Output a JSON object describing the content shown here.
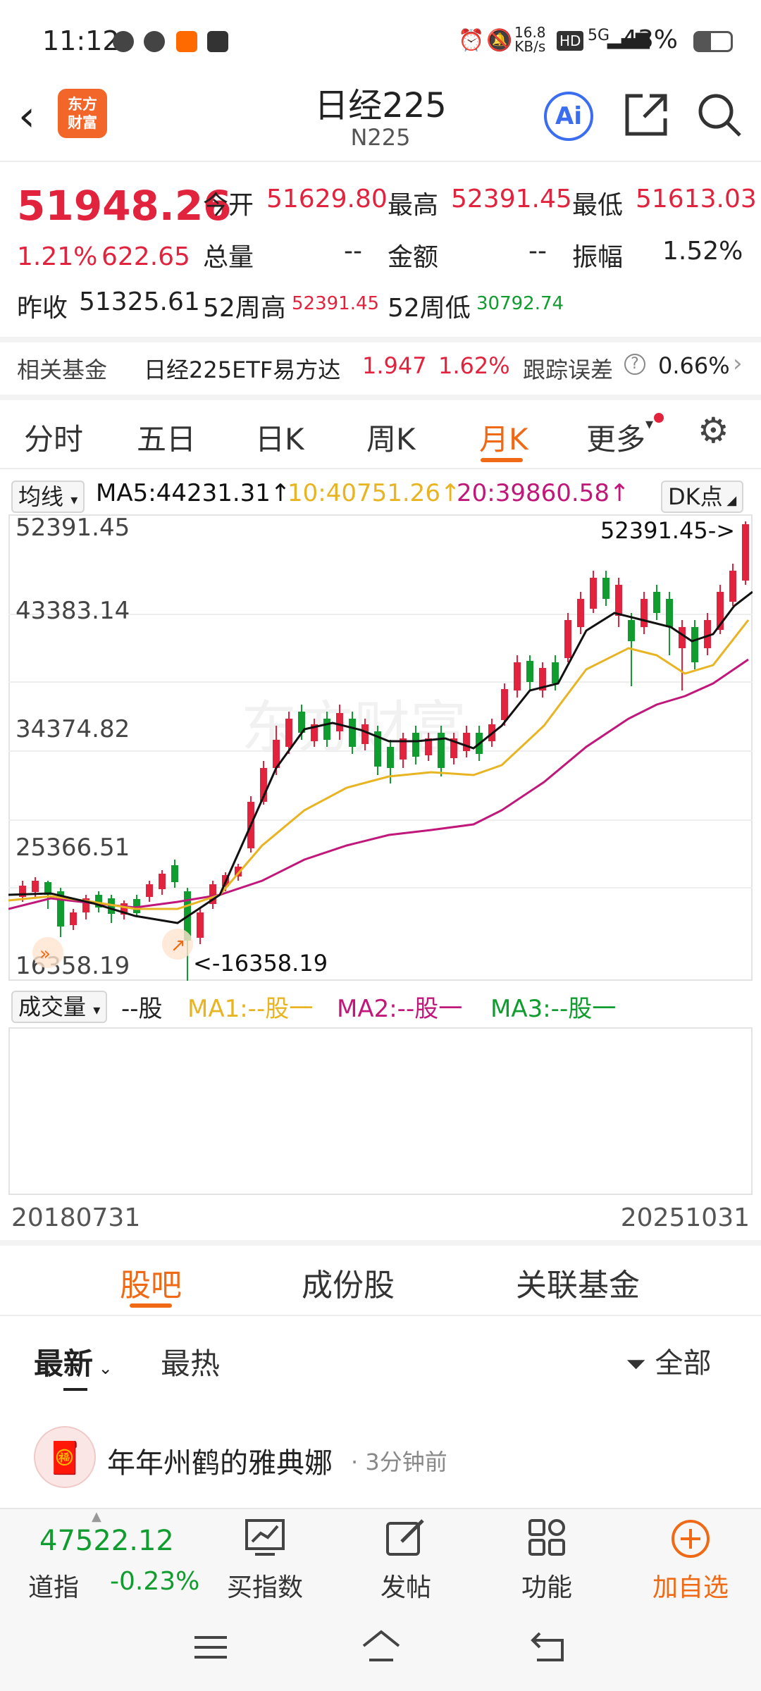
{
  "status_bar": {
    "time": "11:12",
    "speed": "16.8",
    "speed_unit": "KB/s",
    "network": "5G",
    "battery": "43%"
  },
  "header": {
    "title": "日经225",
    "subtitle": "N225",
    "logo_text_1": "东方",
    "logo_text_2": "财富",
    "ai_label": "Ai"
  },
  "quote": {
    "price": "51948.26",
    "change_pct": "1.21%",
    "change": "622.65",
    "prev_close_label": "昨收",
    "prev_close": "51325.61",
    "open_label": "今开",
    "open": "51629.80",
    "high_label": "最高",
    "high": "52391.45",
    "low_label": "最低",
    "low": "51613.03",
    "volume_label": "总量",
    "volume": "--",
    "amount_label": "金额",
    "amount": "--",
    "amplitude_label": "振幅",
    "amplitude": "1.52%",
    "w52_high_label": "52周高",
    "w52_high": "52391.45",
    "w52_low_label": "52周低",
    "w52_low": "30792.74"
  },
  "fund_row": {
    "label": "相关基金",
    "fund_name": "日经225ETF易方达",
    "fund_price": "1.947",
    "fund_pct": "1.62%",
    "tracking_label": "跟踪误差",
    "tracking_value": "0.66%"
  },
  "k_tabs": [
    "分时",
    "五日",
    "日K",
    "周K",
    "月K",
    "更多"
  ],
  "active_k_tab": "月K",
  "ma_row": {
    "selector": "均线",
    "ma5": "MA5:44231.31",
    "ma10": "10:40751.26",
    "ma20": "20:39860.58",
    "dk_button": "DK点"
  },
  "chart": {
    "y_labels": [
      "52391.45",
      "43383.14",
      "34374.82",
      "25366.51",
      "16358.19"
    ],
    "max_marker": "52391.45->",
    "min_marker": "<-16358.19",
    "watermark": "东方财富",
    "colors": {
      "up": "#e2233e",
      "down": "#119c2f",
      "ma5": "#111111",
      "ma10": "#e8b422",
      "ma20": "#c0177a"
    }
  },
  "volume_row": {
    "selector": "成交量",
    "unit": "--股",
    "ma1": "MA1:--股一",
    "ma2": "MA2:--股一",
    "ma3": "MA3:--股一"
  },
  "date_range": {
    "start": "20180731",
    "end": "20251031"
  },
  "sub_tabs": [
    "股吧",
    "成份股",
    "关联基金"
  ],
  "feed_filters": {
    "latest": "最新",
    "hot": "最热",
    "all": "全部"
  },
  "post": {
    "author": "年年州鹤的雅典娜",
    "time": "3分钟前"
  },
  "bottom_bar": {
    "dow_value": "47522.12",
    "dow_label": "道指",
    "dow_pct": "-0.23%",
    "buy_index": "买指数",
    "post": "发帖",
    "functions": "功能",
    "add_watch": "加自选"
  }
}
